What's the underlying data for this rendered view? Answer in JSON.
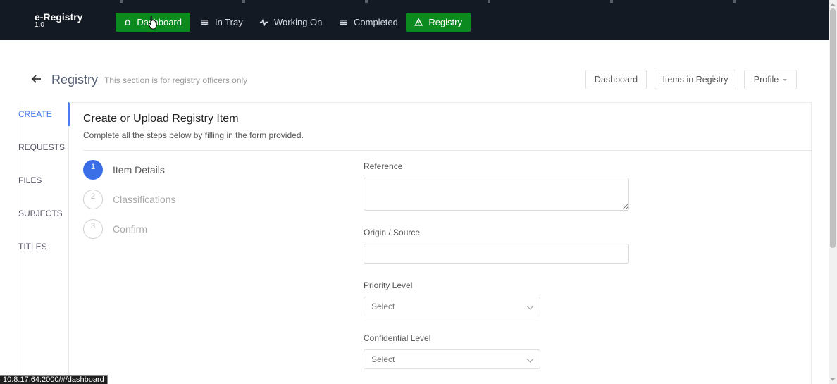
{
  "app": {
    "brand": "e-Registry",
    "version": "1.0"
  },
  "nav": {
    "items": [
      {
        "label": "Dashboard",
        "icon": "home-icon"
      },
      {
        "label": "In Tray",
        "icon": "list-icon"
      },
      {
        "label": "Working On",
        "icon": "activity-icon"
      },
      {
        "label": "Completed",
        "icon": "list-icon"
      },
      {
        "label": "Registry",
        "icon": "warning-icon"
      }
    ]
  },
  "page": {
    "title": "Registry",
    "subtitle": "This section is for registry officers only",
    "buttons": {
      "dashboard": "Dashboard",
      "items": "Items in Registry",
      "profile": "Profile"
    }
  },
  "sidemenu": {
    "items": [
      "CREATE",
      "REQUESTS",
      "FILES",
      "SUBJECTS",
      "TITLES"
    ]
  },
  "card": {
    "title": "Create or Upload Registry Item",
    "description": "Complete all the steps below by filling in the form provided."
  },
  "steps": [
    {
      "number": "1",
      "label": "Item Details"
    },
    {
      "number": "2",
      "label": "Classifications"
    },
    {
      "number": "3",
      "label": "Confirm"
    }
  ],
  "form": {
    "reference_label": "Reference",
    "origin_label": "Origin / Source",
    "priority_label": "Priority Level",
    "priority_value": "Select",
    "confidential_label": "Confidential Level",
    "confidential_value": "Select"
  },
  "status": {
    "url": "10.8.17.64:2000/#/dashboard"
  },
  "colors": {
    "nav_bg": "#141a24",
    "green": "#0b8a1f",
    "accent": "#3b6fe8"
  }
}
